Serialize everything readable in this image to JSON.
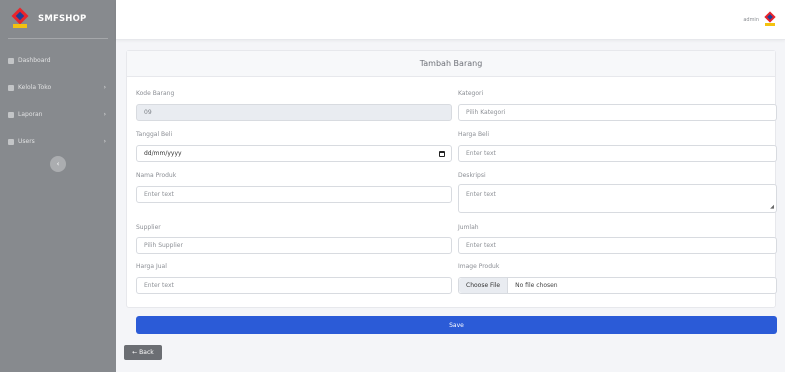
{
  "brand": {
    "name": "SMFSHOP"
  },
  "sidebar": {
    "items": [
      {
        "label": "Dashboard",
        "icon": "dashboard-icon",
        "has_chevron": false
      },
      {
        "label": "Kelola Toko",
        "icon": "cart-icon",
        "has_chevron": true
      },
      {
        "label": "Laporan",
        "icon": "folder-icon",
        "has_chevron": true
      },
      {
        "label": "Users",
        "icon": "users-icon",
        "has_chevron": true
      }
    ],
    "chevron": "›",
    "toggle": "‹"
  },
  "topbar": {
    "user": "admin"
  },
  "form": {
    "title": "Tambah Barang",
    "kode_barang": {
      "label": "Kode Barang",
      "value": "09"
    },
    "kategori": {
      "label": "Kategori",
      "value": "Pilih Kategori"
    },
    "tanggal_beli": {
      "label": "Tanggal Beli",
      "placeholder": "dd/mm/yyyy"
    },
    "harga_beli": {
      "label": "Harga Beli",
      "placeholder": "Enter text"
    },
    "nama_produk": {
      "label": "Nama Produk",
      "placeholder": "Enter text"
    },
    "deskripsi": {
      "label": "Deskripsi",
      "placeholder": "Enter text"
    },
    "supplier": {
      "label": "Supplier",
      "value": "Pilih Supplier"
    },
    "jumlah": {
      "label": "Jumlah",
      "placeholder": "Enter text"
    },
    "harga_jual": {
      "label": "Harga Jual",
      "placeholder": "Enter text"
    },
    "image_produk": {
      "label": "Image Produk",
      "button": "Choose File",
      "status": "No file chosen"
    },
    "save_label": "Save"
  },
  "back_label": "← Back",
  "colors": {
    "sidebar": "#878a8e",
    "primary": "#2b5bd7",
    "back": "#6b6e73"
  }
}
